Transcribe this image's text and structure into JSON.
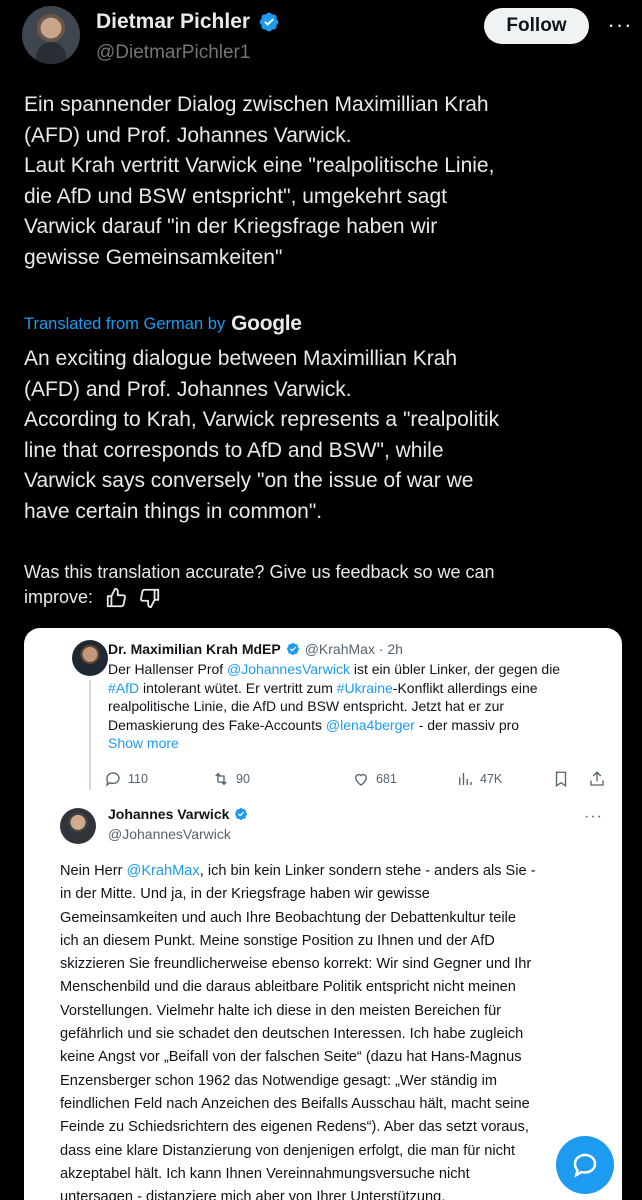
{
  "author": {
    "display_name": "Dietmar Pichler",
    "handle": "@DietmarPichler1",
    "follow_label": "Follow",
    "more_label": "···"
  },
  "tweet": {
    "original_lines": [
      "Ein spannender Dialog zwischen Maximillian Krah",
      "(AFD) und Prof. Johannes Varwick.",
      "Laut Krah vertritt Varwick eine \"realpolitische Linie,",
      "die AfD und BSW entspricht\", umgekehrt sagt",
      "Varwick darauf \"in der Kriegsfrage haben wir",
      "gewisse Gemeinsamkeiten\""
    ],
    "translated_from": "Translated from German by",
    "translator": "Google",
    "translated_lines": [
      "An exciting dialogue between Maximillian Krah",
      "(AFD) and Prof. Johannes Varwick.",
      "According to Krah, Varwick represents a \"realpolitik",
      "line that corresponds to AfD and BSW\", while",
      "Varwick says conversely \"on the issue of war we",
      "have certain things in common\"."
    ],
    "feedback_line1": "Was this translation accurate? Give us feedback so we can",
    "feedback_line2": "improve:"
  },
  "embedded": {
    "q1": {
      "name": "Dr. Maximilian Krah MdEP",
      "handle_time": "@KrahMax · 2h",
      "line1_pre": "Der Hallenser Prof ",
      "line1_link": "@JohannesVarwick",
      "line1_post": " ist ein übler Linker, der gegen die",
      "line2_link": "#AfD",
      "line2_mid": " intolerant wütet. Er vertritt zum ",
      "line2_link2": "#Ukraine",
      "line2_post": "-Konflikt allerdings eine",
      "line3": "realpolitische Linie, die AfD und BSW entspricht. Jetzt hat er zur",
      "line4_pre": "Demaskierung des Fake-Accounts ",
      "line4_link": "@lena4berger",
      "line4_post": " - der massiv pro",
      "show_more": "Show more",
      "replies": "110",
      "reposts": "90",
      "likes": "681",
      "views": "47K"
    },
    "q2": {
      "name": "Johannes Varwick",
      "handle": "@JohannesVarwick",
      "more": "···",
      "line1_pre": "Nein Herr ",
      "line1_link": "@KrahMax",
      "line1_post": ", ich bin kein Linker sondern stehe - anders als Sie -",
      "lines": [
        "in der Mitte. Und ja, in der Kriegsfrage haben wir gewisse",
        "Gemeinsamkeiten und auch Ihre Beobachtung der Debattenkultur teile",
        "ich an diesem Punkt. Meine sonstige Position zu Ihnen und der AfD",
        "skizzieren Sie freundlicherweise ebenso korrekt: Wir sind Gegner und Ihr",
        "Menschenbild und die daraus ableitbare Politik entspricht nicht meinen",
        "Vorstellungen. Vielmehr halte ich diese in den meisten Bereichen für",
        "gefährlich und sie schadet den deutschen Interessen. Ich habe zugleich",
        "keine Angst vor „Beifall von der falschen Seite“ (dazu hat Hans-Magnus",
        "Enzensberger schon 1962 das Notwendige gesagt: „Wer ständig im",
        "feindlichen Feld nach Anzeichen des Beifalls Ausschau hält, macht seine",
        "Feinde zu Schiedsrichtern des eigenen Redens“). Aber das setzt voraus,",
        "dass eine klare Distanzierung von denjenigen erfolgt, die man für nicht",
        "akzeptabel hält. Ich kann Ihnen Vereinnahmungsversuche nicht",
        "untersagen - distanziere mich aber von Ihrer Unterstützung."
      ]
    }
  },
  "colors": {
    "background": "#000000",
    "accent": "#1d9bf0",
    "text": "#e7e9ea",
    "muted": "#71767b"
  },
  "icons": [
    "verified-badge-icon",
    "more-icon",
    "thumbs-up-icon",
    "thumbs-down-icon",
    "reply-icon",
    "repost-icon",
    "like-icon",
    "views-icon",
    "bookmark-icon",
    "share-icon",
    "chat-bubble-icon"
  ]
}
